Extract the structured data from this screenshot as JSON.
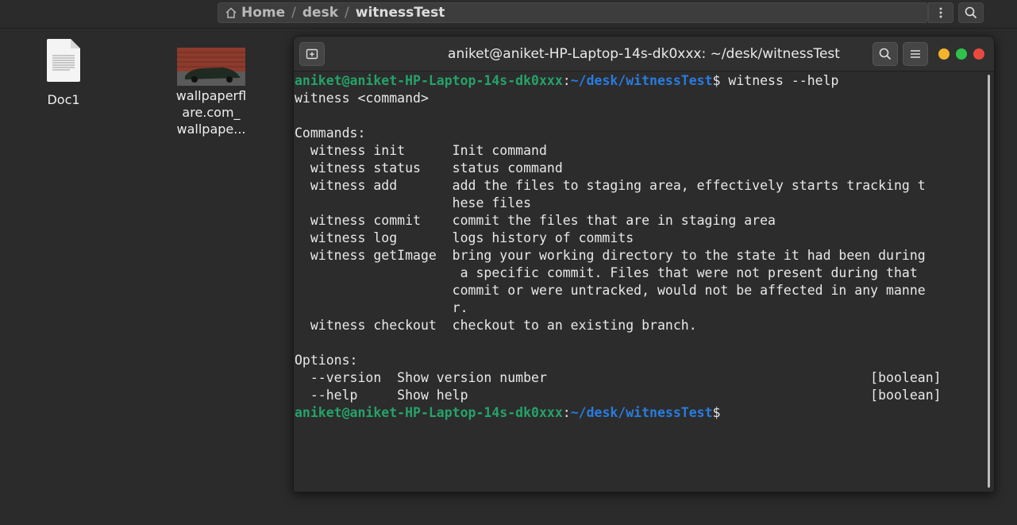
{
  "file_manager": {
    "breadcrumb": [
      "Home",
      "desk",
      "witnessTest"
    ]
  },
  "desktop": {
    "items": [
      {
        "label": "Doc1",
        "icon": "document-icon"
      },
      {
        "label_lines": [
          "wallpaperfl",
          "are.com_",
          "wallpape..."
        ],
        "icon": "image-thumbnail"
      }
    ]
  },
  "terminal": {
    "title": "aniket@aniket-HP-Laptop-14s-dk0xxx: ~/desk/witnessTest",
    "prompt_user": "aniket@aniket-HP-Laptop-14s-dk0xxx",
    "prompt_path": "~/desk/witnessTest",
    "command": " witness --help",
    "output_lines": [
      "witness <command>",
      "",
      "Commands:",
      "  witness init      Init command",
      "  witness status    status command",
      "  witness add       add the files to staging area, effectively starts tracking t",
      "                    hese files",
      "  witness commit    commit the files that are in staging area",
      "  witness log       logs history of commits",
      "  witness getImage  bring your working directory to the state it had been during",
      "                     a specific commit. Files that were not present during that",
      "                    commit or were untracked, would not be affected in any manne",
      "                    r.",
      "  witness checkout  checkout to an existing branch.",
      "",
      "Options:",
      "  --version  Show version number                                         [boolean]",
      "  --help     Show help                                                   [boolean]"
    ]
  },
  "colors": {
    "prompt_user": "#26a269",
    "prompt_path": "#2a7bde",
    "close": "#e94a3e",
    "minimize": "#f3b32d",
    "maximize": "#2fc24b"
  }
}
